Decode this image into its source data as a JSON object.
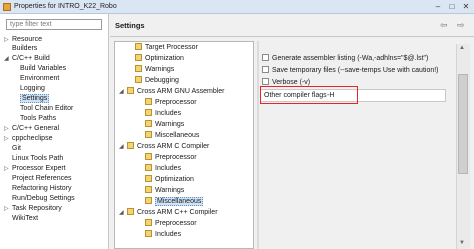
{
  "window": {
    "title": "Properties for INTRO_K22_Robo",
    "minimize_glyph": "–",
    "maximize_glyph": "□",
    "close_glyph": "✕"
  },
  "sidebar": {
    "filter_placeholder": "type filter text",
    "items": [
      {
        "label": "Resource",
        "arrow": "▷"
      },
      {
        "label": "Builders",
        "arrow": ""
      },
      {
        "label": "C/C++ Build",
        "arrow": "◢"
      },
      {
        "label": "Build Variables",
        "arrow": ""
      },
      {
        "label": "Environment",
        "arrow": ""
      },
      {
        "label": "Logging",
        "arrow": ""
      },
      {
        "label": "Settings",
        "arrow": ""
      },
      {
        "label": "Tool Chain Editor",
        "arrow": ""
      },
      {
        "label": "Tools Paths",
        "arrow": ""
      },
      {
        "label": "C/C++ General",
        "arrow": "▷"
      },
      {
        "label": "cppcheclipse",
        "arrow": "▷"
      },
      {
        "label": "Git",
        "arrow": ""
      },
      {
        "label": "Linux Tools Path",
        "arrow": ""
      },
      {
        "label": "Processor Expert",
        "arrow": "▷"
      },
      {
        "label": "Project References",
        "arrow": ""
      },
      {
        "label": "Refactoring History",
        "arrow": ""
      },
      {
        "label": "Run/Debug Settings",
        "arrow": ""
      },
      {
        "label": "Task Repository",
        "arrow": "▷"
      },
      {
        "label": "WikiText",
        "arrow": ""
      }
    ]
  },
  "settings": {
    "title": "Settings",
    "back_glyph": "⇦",
    "forward_glyph": "⇨"
  },
  "tree": {
    "items": [
      {
        "label": "Target Processor",
        "arrow": ""
      },
      {
        "label": "Optimization",
        "arrow": ""
      },
      {
        "label": "Warnings",
        "arrow": ""
      },
      {
        "label": "Debugging",
        "arrow": ""
      },
      {
        "label": "Cross ARM GNU Assembler",
        "arrow": "◢"
      },
      {
        "label": "Preprocessor",
        "arrow": ""
      },
      {
        "label": "Includes",
        "arrow": ""
      },
      {
        "label": "Warnings",
        "arrow": ""
      },
      {
        "label": "Miscellaneous",
        "arrow": ""
      },
      {
        "label": "Cross ARM C Compiler",
        "arrow": "◢"
      },
      {
        "label": "Preprocessor",
        "arrow": ""
      },
      {
        "label": "Includes",
        "arrow": ""
      },
      {
        "label": "Optimization",
        "arrow": ""
      },
      {
        "label": "Warnings",
        "arrow": ""
      },
      {
        "label": "Miscellaneous",
        "arrow": ""
      },
      {
        "label": "Cross ARM C++ Compiler",
        "arrow": "◢"
      },
      {
        "label": "Preprocessor",
        "arrow": ""
      },
      {
        "label": "Includes",
        "arrow": ""
      }
    ]
  },
  "options": {
    "checkboxes": [
      {
        "label": "Generate assembler listing (-Wa,-adhlns=\"$@.lst\")",
        "checked": false
      },
      {
        "label": "Save temporary files (--save-temps Use with caution!)",
        "checked": false
      },
      {
        "label": "Verbose (-v)",
        "checked": false
      }
    ],
    "other_flags_label": "Other compiler flags",
    "other_flags_value": "-H"
  },
  "scrollbar": {
    "up_glyph": "▲",
    "down_glyph": "▼"
  },
  "colors": {
    "highlight": "#e0262b",
    "selection": "#cde3f7",
    "folder": "#f5d470"
  }
}
